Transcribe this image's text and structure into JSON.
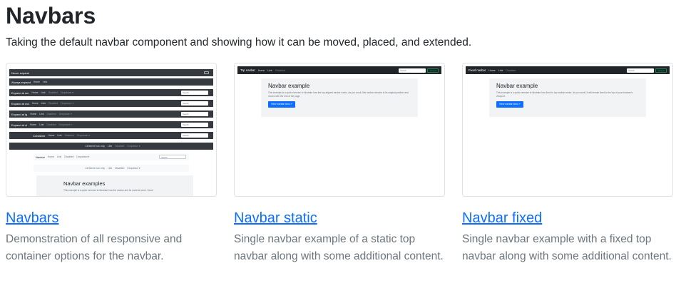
{
  "section": {
    "title": "Navbars",
    "lead": "Taking the default navbar component and showing how it can be moved, placed, and extended."
  },
  "cards": [
    {
      "title": "Navbars",
      "description": "Demonstration of all responsive and container options for the navbar."
    },
    {
      "title": "Navbar static",
      "description": "Single navbar example of a static top navbar along with some additional content."
    },
    {
      "title": "Navbar fixed",
      "description": "Single navbar example with a fixed top navbar along with some additional content."
    }
  ],
  "thumb1": {
    "rows": [
      {
        "brand": "Never expand"
      },
      {
        "brand": "Always expand",
        "links": [
          "Home",
          "Link"
        ]
      },
      {
        "brand": "Expand at sm",
        "links": [
          "Home",
          "Link",
          "Disabled",
          "Dropdown ▾"
        ],
        "search": "Search"
      },
      {
        "brand": "Expand at md",
        "links": [
          "Home",
          "Link",
          "Disabled",
          "Dropdown ▾"
        ],
        "search": "Search"
      },
      {
        "brand": "Expand at lg",
        "links": [
          "Home",
          "Link",
          "Disabled",
          "Dropdown ▾"
        ],
        "search": "Search"
      },
      {
        "brand": "Expand at xl",
        "links": [
          "Home",
          "Link",
          "Disabled",
          "Dropdown ▾"
        ],
        "search": "Search"
      },
      {
        "brand": "Container",
        "links": [
          "Home",
          "Link",
          "Disabled",
          "Dropdown ▾"
        ],
        "search": "Search"
      },
      {
        "brand": "",
        "links": [
          "Centered nav only",
          "Link",
          "Disabled",
          "Dropdown ▾"
        ]
      },
      {
        "brand": "Navbar",
        "links": [
          "Home",
          "Link",
          "Disabled",
          "Dropdown ▾"
        ],
        "search": "Search"
      },
      {
        "brand": "",
        "links": [
          "Centered nav only",
          "Link",
          "Disabled",
          "Dropdown ▾"
        ]
      }
    ],
    "jumbo_title": "Navbar examples",
    "jumbo_text": "This example is a quick exercise to illustrate how the navbar and its contents work. Some"
  },
  "thumb2": {
    "brand": "Top navbar",
    "links": [
      "Home",
      "Link",
      "Disabled"
    ],
    "search": "Search",
    "button": "Search",
    "jumbo_title": "Navbar example",
    "jumbo_text": "This example is a quick exercise to illustrate how the top-aligned navbar works. As you scroll, this navbar remains in its original position and moves with the rest of the page.",
    "jumbo_button": "View navbar docs »"
  },
  "thumb3": {
    "brand": "Fixed navbar",
    "links": [
      "Home",
      "Link",
      "Disabled"
    ],
    "search": "Search",
    "button": "Search",
    "jumbo_title": "Navbar example",
    "jumbo_text": "This example is a quick exercise to illustrate how fixed to top navbar works. As you scroll, it will remain fixed to the top of your browser's viewport.",
    "jumbo_button": "View navbar docs »"
  }
}
